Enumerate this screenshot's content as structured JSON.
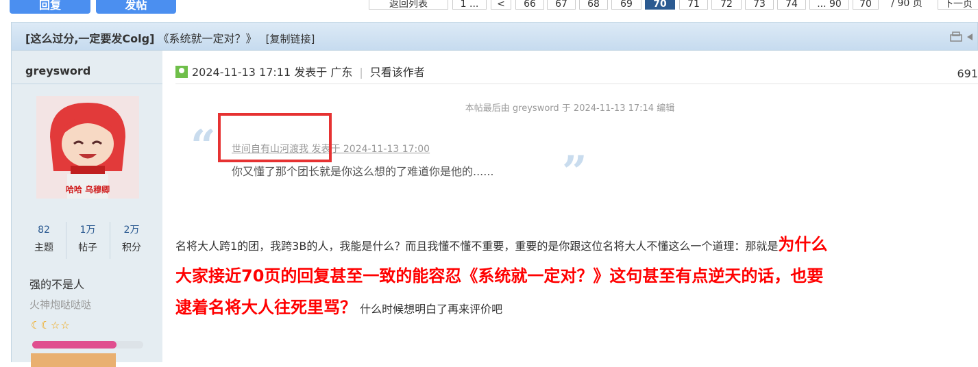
{
  "top": {
    "reply_button": "回复",
    "post_button": "发帖",
    "back_list": "返回列表",
    "first_page": "1 ...",
    "prev_label": "<",
    "pages": [
      "66",
      "67",
      "68",
      "69",
      "70",
      "71",
      "72",
      "73",
      "74"
    ],
    "current_page": "70",
    "last_page": "... 90",
    "page_input": "70",
    "page_total": "/ 90 页",
    "next_label": "下一页"
  },
  "thread": {
    "title_prefix": "[这么过分,一定要发Colg]",
    "title_main": "《系统就一定对？》",
    "copy_link": "[复制链接]"
  },
  "author": {
    "name": "greysword",
    "avatar_caption": "哈哈  乌穆卿",
    "stats": [
      {
        "num": "82",
        "label": "主题"
      },
      {
        "num": "1万",
        "label": "帖子"
      },
      {
        "num": "2万",
        "label": "积分"
      }
    ],
    "rank": "强的不是人",
    "group": "火神炮哒哒哒",
    "stars": "☾☾☆☆",
    "level_progress": 0.76
  },
  "post": {
    "meta_time": "2024-11-13 17:11 发表于 广东",
    "only_author": "只看该作者",
    "floor": "691",
    "edit_note": "本帖最后由 greysword 于 2024-11-13 17:14 编辑",
    "quote_head": "世间自有山河渡我 发表于 2024-11-13 17:00",
    "quote_body": "你又懂了那个团长就是你这么想的了难道你是他的......",
    "line1_normal": "名将大人跨1的团，我跨3B的人，我能是什么？而且我懂不懂不重要，重要的是你跟这位名将大人不懂这么一个道理：那就是",
    "line1_big": "为什么",
    "line2_big": "大家接近70页的回复甚至一致的能容忍《系统就一定对？》这句甚至有点逆天的话，也要",
    "line3_big": "逮着名将大人往死里骂？",
    "line3_normal": " 什么时候想明白了再来评价吧"
  }
}
